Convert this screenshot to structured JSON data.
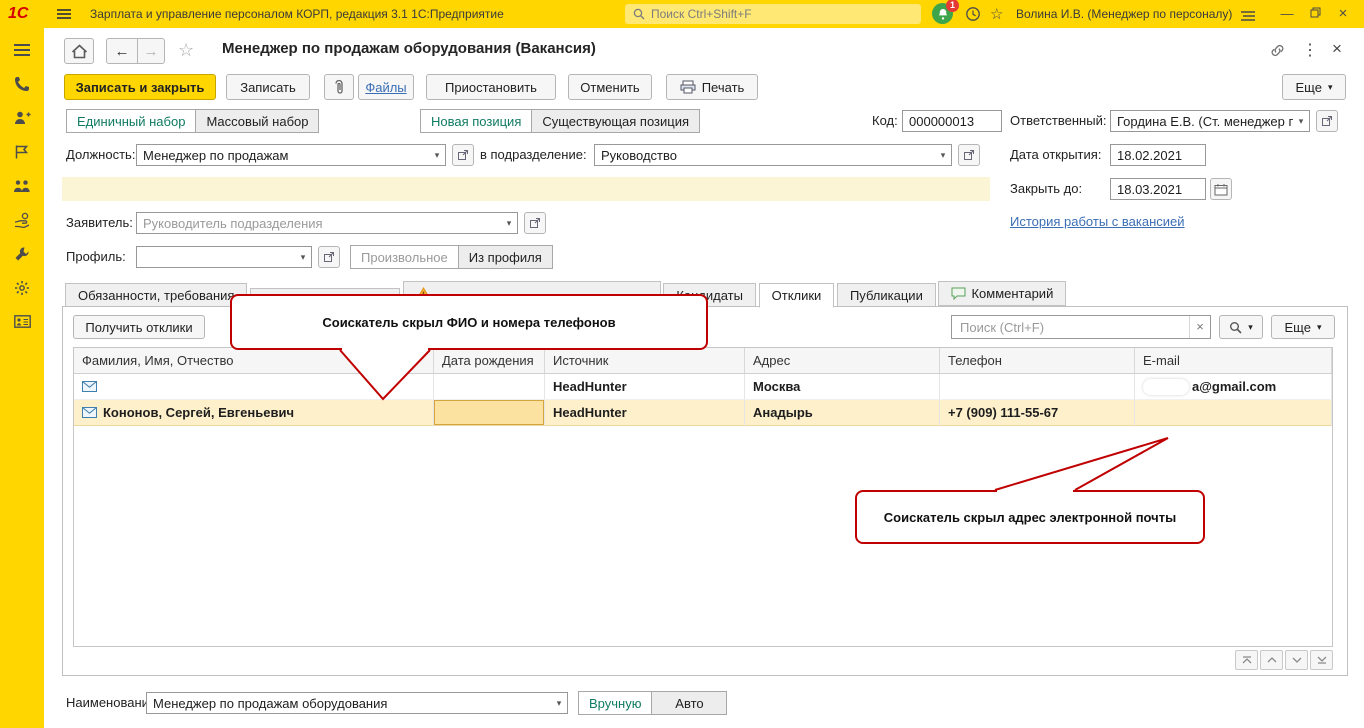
{
  "icons": {
    "dropdown": "▾",
    "close": "×",
    "dots": "⋮",
    "back": "←",
    "forward": "→",
    "star_outline": "☆",
    "minimize": "—",
    "clear": "×"
  },
  "topbar": {
    "logo": "1С",
    "app_title": "Зарплата и управление персоналом КОРП, редакция 3.1 1С:Предприятие",
    "search_placeholder": "Поиск Ctrl+Shift+F",
    "notification_badge": "1",
    "user_name": "Волина И.В. (Менеджер по персоналу)"
  },
  "window": {
    "title": "Менеджер по продажам оборудования (Вакансия)"
  },
  "toolbar": {
    "save_and_close": "Записать и закрыть",
    "save": "Записать",
    "files": "Файлы",
    "suspend": "Приостановить",
    "cancel": "Отменить",
    "print": "Печать",
    "more": "Еще"
  },
  "form": {
    "recruitment_single": "Единичный набор",
    "recruitment_mass": "Массовый набор",
    "position_new": "Новая позиция",
    "position_existing": "Существующая позиция",
    "code": {
      "label": "Код:",
      "value": "000000013"
    },
    "responsible": {
      "label": "Ответственный:",
      "value": "Гордина Е.В. (Ст. менеджер по"
    },
    "position": {
      "label": "Должность:",
      "value": "Менеджер по продажам"
    },
    "department": {
      "label": "в подразделение:",
      "value": "Руководство"
    },
    "date_opened": {
      "label": "Дата открытия:",
      "value": "18.02.2021"
    },
    "date_close": {
      "label": "Закрыть до:",
      "value": "18.03.2021"
    },
    "applicant": {
      "label": "Заявитель:",
      "placeholder": "Руководитель подразделения"
    },
    "history_link": "История работы с вакансией",
    "profile": {
      "label": "Профиль:"
    },
    "description_custom": "Произвольное",
    "description_from_profile": "Из профиля",
    "naming": {
      "label": "Наименование:",
      "value": "Менеджер по продажам оборудования",
      "manual": "Вручную",
      "auto": "Авто"
    }
  },
  "tabs": [
    {
      "label": "Обязанности, требования"
    },
    {
      "label": ""
    },
    {
      "label": ""
    },
    {
      "label": "Кандидаты"
    },
    {
      "label": "Отклики"
    },
    {
      "label": "Публикации"
    },
    {
      "label": "Комментарий"
    }
  ],
  "responses": {
    "get_button": "Получить отклики",
    "search_placeholder": "Поиск (Ctrl+F)",
    "more": "Еще",
    "columns": [
      "Фамилия, Имя, Отчество",
      "Дата рождения",
      "Источник",
      "Адрес",
      "Телефон",
      "E-mail"
    ],
    "rows": [
      {
        "fio": "",
        "birth_date": "",
        "source": "HeadHunter",
        "address": "Москва",
        "phone": "",
        "email": "a@gmail.com"
      },
      {
        "fio": "Кононов, Сергей, Евгеньевич",
        "birth_date": "",
        "source": "HeadHunter",
        "address": "Анадырь",
        "phone": "+7 (909) 111-55-67",
        "email": ""
      }
    ]
  },
  "callouts": {
    "hidden_fio_phone": "Соискатель скрыл ФИО и номера телефонов",
    "hidden_email": "Соискатель скрыл адрес электронной почты"
  }
}
